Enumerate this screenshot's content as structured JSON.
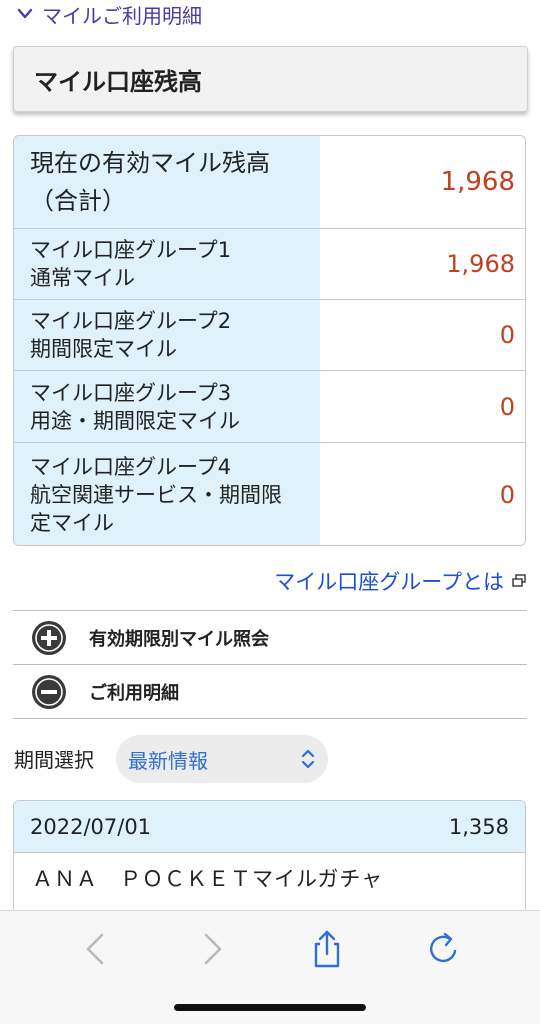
{
  "top_link": {
    "label": "マイルご利用明細",
    "icon": "chevron-down-icon"
  },
  "section_title": "マイル口座残高",
  "balance": {
    "rows": [
      {
        "line1": "現在の有効マイル残高",
        "line2": "（合計）",
        "line3": "",
        "value": "1,968"
      },
      {
        "line1": "マイル口座グループ1",
        "line2": "通常マイル",
        "line3": "",
        "value": "1,968"
      },
      {
        "line1": "マイル口座グループ2",
        "line2": "期間限定マイル",
        "line3": "",
        "value": "0"
      },
      {
        "line1": "マイル口座グループ3",
        "line2": "用途・期間限定マイル",
        "line3": "",
        "value": "0"
      },
      {
        "line1": "マイル口座グループ4",
        "line2": "航空関連サービス・期間限",
        "line3": "定マイル",
        "value": "0"
      }
    ]
  },
  "group_link": {
    "label": "マイル口座グループとは",
    "icon": "external-window-icon"
  },
  "accordions": [
    {
      "label": "有効期限別マイル照会",
      "icon": "plus-circle-icon"
    },
    {
      "label": "ご利用明細",
      "icon": "minus-circle-icon"
    }
  ],
  "period": {
    "label": "期間選択",
    "selected": "最新情報",
    "icon": "up-down-chevron-icon"
  },
  "history": {
    "date": "2022/07/01",
    "miles": "1,358",
    "description": "ＡＮＡ　ＰＯＣＫＥＴマイルガチャ"
  },
  "toolbar": {
    "back": "back-icon",
    "forward": "forward-icon",
    "share": "share-icon",
    "reload": "reload-icon"
  },
  "colors": {
    "accent_link": "#1f4fd1",
    "value_red": "#c0411d",
    "label_bg": "#dff1fb",
    "top_link": "#4a3aa8"
  }
}
